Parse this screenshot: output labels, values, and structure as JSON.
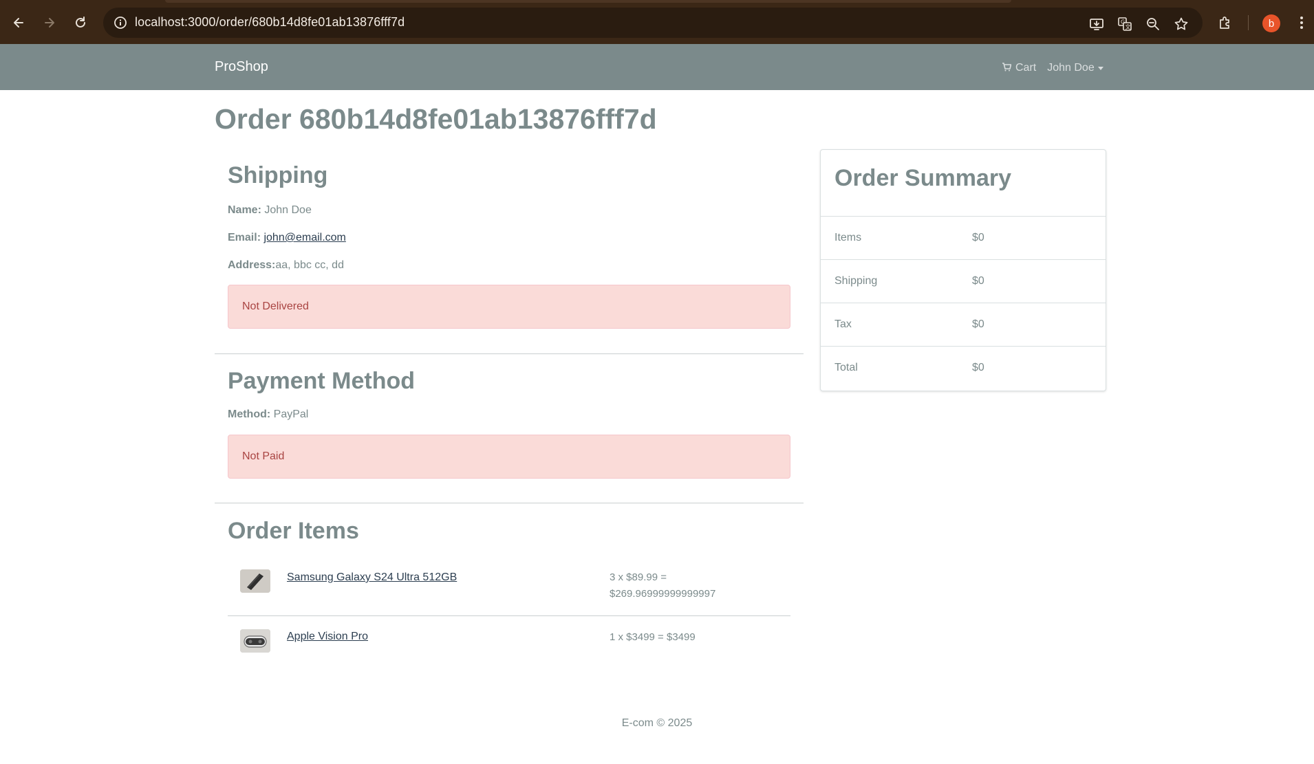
{
  "browser": {
    "url": "localhost:3000/order/680b14d8fe01ab13876fff7d",
    "avatar_letter": "b"
  },
  "navbar": {
    "brand": "ProShop",
    "cart_label": "Cart",
    "user_label": "John Doe"
  },
  "order": {
    "title": "Order 680b14d8fe01ab13876fff7d",
    "shipping": {
      "heading": "Shipping",
      "name_label": "Name:",
      "name_value": "John Doe",
      "email_label": "Email:",
      "email_value": "john@email.com",
      "address_label": "Address:",
      "address_value": "aa, bbc cc, dd",
      "status": "Not Delivered"
    },
    "payment": {
      "heading": "Payment Method",
      "method_label": "Method:",
      "method_value": "PayPal",
      "status": "Not Paid"
    },
    "items": {
      "heading": "Order Items",
      "list": [
        {
          "name": "Samsung Galaxy S24 Ultra 512GB",
          "price_line1": "3 x $89.99 =",
          "price_line2": "$269.96999999999997"
        },
        {
          "name": "Apple Vision Pro",
          "price_line1": "1 x $3499 = $3499",
          "price_line2": ""
        }
      ]
    }
  },
  "summary": {
    "heading": "Order Summary",
    "rows": [
      {
        "label": "Items",
        "value": "$0"
      },
      {
        "label": "Shipping",
        "value": "$0"
      },
      {
        "label": "Tax",
        "value": "$0"
      },
      {
        "label": "Total",
        "value": "$0"
      }
    ]
  },
  "footer": {
    "text": "E-com © 2025"
  },
  "colors": {
    "primary": "#7b8a8b",
    "link": "#2c3e50",
    "alert_bg": "#fadbd8",
    "alert_text": "#a94442",
    "chrome_bg": "#3b2716"
  }
}
